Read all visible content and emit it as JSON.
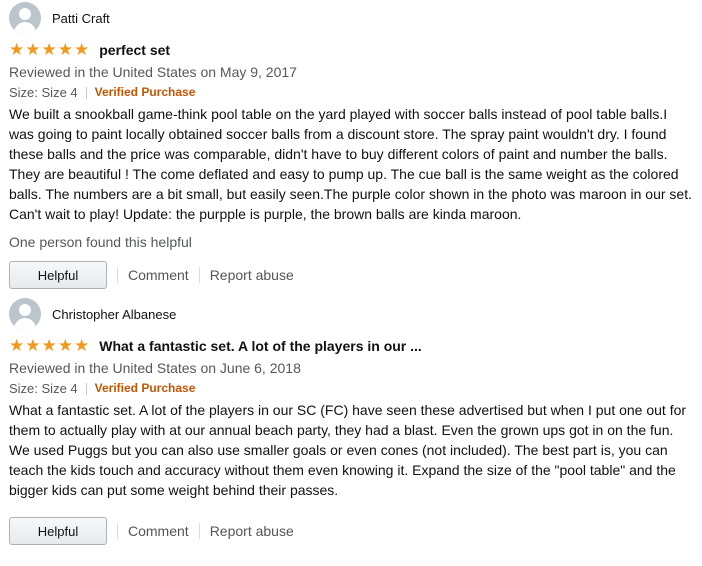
{
  "reviews": [
    {
      "author": "Patti Craft",
      "rating": 5,
      "title": "perfect set",
      "date": "Reviewed in the United States on May 9, 2017",
      "size": "Size: Size 4",
      "verified": "Verified Purchase",
      "body": "We built a snookball game-think pool table on the yard played with soccer balls instead of pool table balls.I was going to paint locally obtained soccer balls from a discount store. The spray paint wouldn't dry. I found these balls and the price was comparable, didn't have to buy different colors of paint and number the balls. They are beautiful ! The come deflated and easy to pump up. The cue ball is the same weight as the colored balls. The numbers are a bit small, but easily seen.The purple color shown in the photo was maroon in our set. Can't wait to play! Update: the purpple is purple, the brown balls are kinda maroon.",
      "helpful_count": "One person found this helpful",
      "helpful_label": "Helpful",
      "comment_label": "Comment",
      "report_label": "Report abuse"
    },
    {
      "author": "Christopher Albanese",
      "rating": 5,
      "title": "What a fantastic set. A lot of the players in our ...",
      "date": "Reviewed in the United States on June 6, 2018",
      "size": "Size: Size 4",
      "verified": "Verified Purchase",
      "body": "What a fantastic set. A lot of the players in our SC (FC) have seen these advertised but when I put one out for them to actually play with at our annual beach party, they had a blast. Even the grown ups got in on the fun. We used Puggs but you can also use smaller goals or even cones (not included). The best part is, you can teach the kids touch and accuracy without them even knowing it. Expand the size of the \"pool table\" and the bigger kids can put some weight behind their passes.",
      "helpful_label": "Helpful",
      "comment_label": "Comment",
      "report_label": "Report abuse"
    }
  ],
  "colors": {
    "star": "#f29a1f",
    "verified": "#c45500"
  },
  "icons": {
    "avatar": "avatar-icon",
    "star": "star-icon"
  }
}
